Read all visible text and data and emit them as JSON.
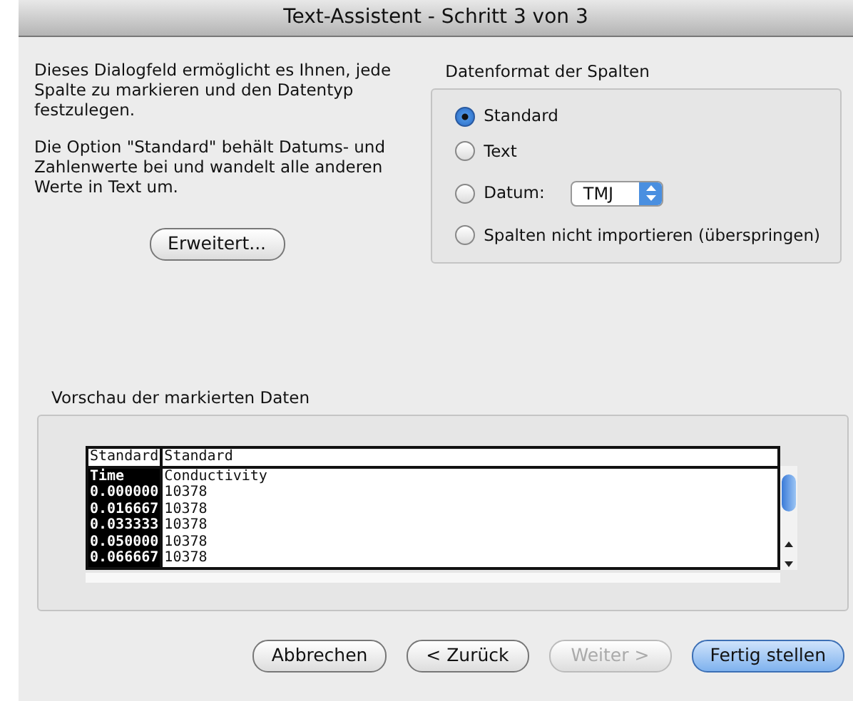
{
  "window": {
    "title": "Text-Assistent - Schritt 3 von 3"
  },
  "intro": [
    "Dieses Dialogfeld ermöglicht es Ihnen, jede Spalte zu markieren und den Datentyp festzulegen.",
    "Die Option \"Standard\" behält Datums- und Zahlenwerte bei und wandelt alle anderen Werte in Text um."
  ],
  "advanced_button": "Erweitert...",
  "format_group": {
    "title": "Datenformat der Spalten",
    "options": [
      {
        "label": "Standard",
        "selected": true
      },
      {
        "label": "Text",
        "selected": false
      },
      {
        "label": "Datum:",
        "selected": false,
        "select_value": "TMJ"
      },
      {
        "label": "Spalten nicht importieren (überspringen)",
        "selected": false
      }
    ]
  },
  "preview": {
    "title": "Vorschau der markierten Daten",
    "columns": [
      {
        "header": "Standard",
        "selected": true,
        "cells": [
          "Time",
          "0.000000",
          "0.016667",
          "0.033333",
          "0.050000",
          "0.066667"
        ]
      },
      {
        "header": "Standard",
        "selected": false,
        "cells": [
          "Conductivity",
          "10378",
          "10378",
          "10378",
          "10378",
          "10378"
        ]
      }
    ]
  },
  "buttons": [
    {
      "label": "Abbrechen",
      "disabled": false,
      "default": false
    },
    {
      "label": "< Zurück",
      "disabled": false,
      "default": false
    },
    {
      "label": "Weiter >",
      "disabled": true,
      "default": false
    },
    {
      "label": "Fertig stellen",
      "disabled": false,
      "default": true
    }
  ]
}
